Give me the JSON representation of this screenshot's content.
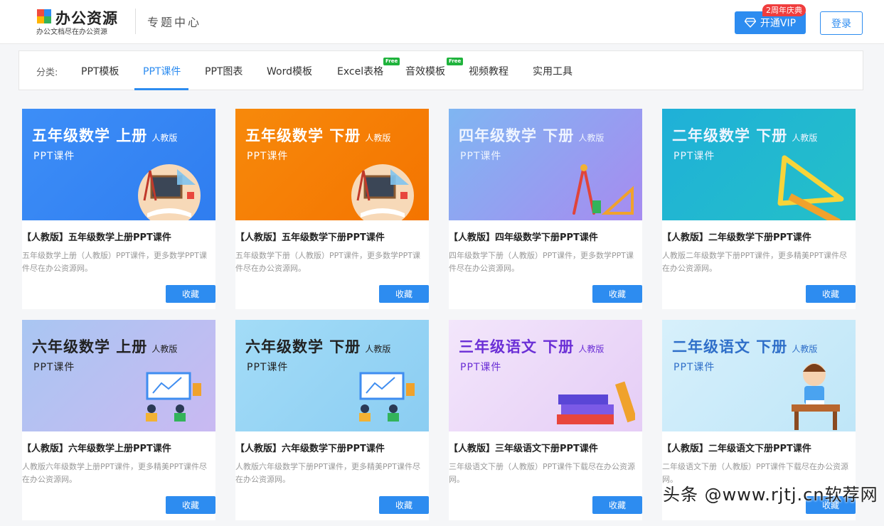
{
  "header": {
    "logo_name": "办公资源",
    "logo_slogan": "办公文档尽在办公资源",
    "section_title": "专题中心",
    "vip_label": "开通VIP",
    "vip_badge": "2周年庆典",
    "login_label": "登录",
    "accent_color": "#2d8cf0"
  },
  "categories": {
    "label": "分类:",
    "items": [
      {
        "label": "PPT模板",
        "active": false,
        "free": false
      },
      {
        "label": "PPT课件",
        "active": true,
        "free": false
      },
      {
        "label": "PPT图表",
        "active": false,
        "free": false
      },
      {
        "label": "Word模板",
        "active": false,
        "free": false
      },
      {
        "label": "Excel表格",
        "active": false,
        "free": true
      },
      {
        "label": "音效模板",
        "active": false,
        "free": true
      },
      {
        "label": "视频教程",
        "active": false,
        "free": false
      },
      {
        "label": "实用工具",
        "active": false,
        "free": false
      }
    ],
    "free_tag": "Free"
  },
  "cards": [
    {
      "thumb_title": "五年级数学 上册",
      "thumb_edition": "人教版",
      "thumb_sub": "PPT课件",
      "title": "【人教版】五年级数学上册PPT课件",
      "desc": "五年级数学上册（人教版）PPT课件，更多数学PPT课件尽在办公资源网。",
      "button": "收藏"
    },
    {
      "thumb_title": "五年级数学 下册",
      "thumb_edition": "人教版",
      "thumb_sub": "PPT课件",
      "title": "【人教版】五年级数学下册PPT课件",
      "desc": "五年级数学下册（人教版）PPT课件，更多数学PPT课件尽在办公资源网。",
      "button": "收藏"
    },
    {
      "thumb_title": "四年级数学 下册",
      "thumb_edition": "人教版",
      "thumb_sub": "PPT课件",
      "title": "【人教版】四年级数学下册PPT课件",
      "desc": "四年级数学下册（人教版）PPT课件，更多数学PPT课件尽在办公资源网。",
      "button": "收藏"
    },
    {
      "thumb_title": "二年级数学 下册",
      "thumb_edition": "人教版",
      "thumb_sub": "PPT课件",
      "title": "【人教版】二年级数学下册PPT课件",
      "desc": "人教版二年级数学下册PPT课件，更多精美PPT课件尽在办公资源网。",
      "button": "收藏"
    },
    {
      "thumb_title": "六年级数学 上册",
      "thumb_edition": "人教版",
      "thumb_sub": "PPT课件",
      "title": "【人教版】六年级数学上册PPT课件",
      "desc": "人教版六年级数学上册PPT课件，更多精美PPT课件尽在办公资源网。",
      "button": "收藏"
    },
    {
      "thumb_title": "六年级数学 下册",
      "thumb_edition": "人教版",
      "thumb_sub": "PPT课件",
      "title": "【人教版】六年级数学下册PPT课件",
      "desc": "人教版六年级数学下册PPT课件，更多精美PPT课件尽在办公资源网。",
      "button": "收藏"
    },
    {
      "thumb_title": "三年级语文 下册",
      "thumb_edition": "人教版",
      "thumb_sub": "PPT课件",
      "title": "【人教版】三年级语文下册PPT课件",
      "desc": "三年级语文下册（人教版）PPT课件下载尽在办公资源网。",
      "button": "收藏"
    },
    {
      "thumb_title": "二年级语文 下册",
      "thumb_edition": "人教版",
      "thumb_sub": "PPT课件",
      "title": "【人教版】二年级语文下册PPT课件",
      "desc": "二年级语文下册（人教版）PPT课件下载尽在办公资源网。",
      "button": "收藏"
    }
  ],
  "watermark": "头条 @www.rjtj.cn软荐网"
}
